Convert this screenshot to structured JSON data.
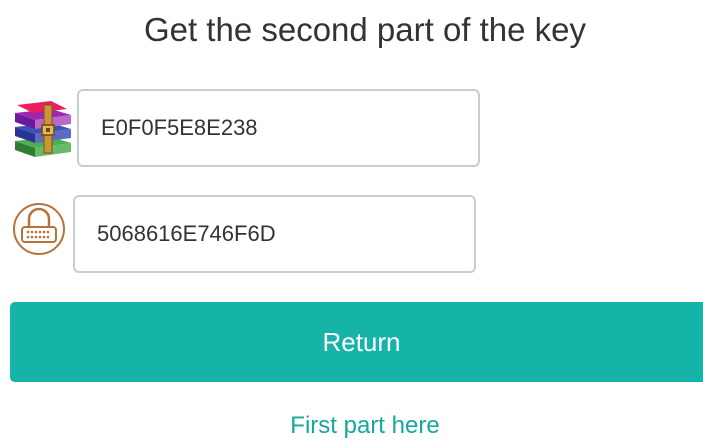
{
  "heading": "Get the second part of the key",
  "fields": {
    "archive_key": {
      "value": "E0F0F5E8E238",
      "icon": "winrar-archive-icon"
    },
    "password_key": {
      "value": "5068616E746F6D",
      "icon": "password-lock-icon"
    }
  },
  "actions": {
    "return_label": "Return",
    "first_part_link": "First part here"
  },
  "colors": {
    "accent": "#16b3a8",
    "link": "#16a89e",
    "text": "#333333",
    "field_border": "#cccccc",
    "icon_brown": "#b5733a"
  }
}
